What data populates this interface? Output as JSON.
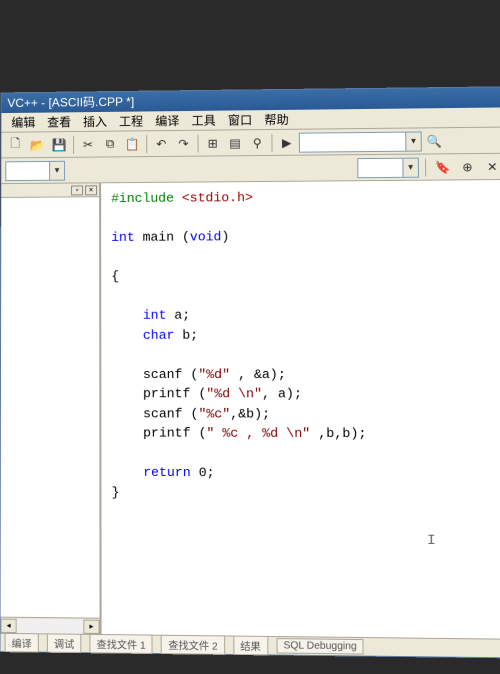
{
  "title": "VC++ - [ASCII码.CPP *]",
  "menu": {
    "items": [
      "编辑",
      "查看",
      "插入",
      "工程",
      "编译",
      "工具",
      "窗口",
      "帮助"
    ]
  },
  "toolbar1": {
    "buttons": [
      "new",
      "open",
      "save",
      "cut",
      "copy",
      "paste",
      "undo",
      "redo",
      "workspace",
      "window",
      "find",
      "run"
    ]
  },
  "code": {
    "include_kw": "#include",
    "include_hdr": "<stdio.h>",
    "int_kw": "int",
    "main": " main (",
    "void_kw": "void",
    "main_close": ")",
    "brace_open": "{",
    "indent": "    ",
    "int_kw2": "int",
    "var_a": " a;",
    "char_kw": "char",
    "var_b": " b;",
    "scanf1_pre": "scanf (",
    "scanf1_str": "\"%d\"",
    "scanf1_post": " , &a);",
    "printf1_pre": "printf (",
    "printf1_str": "\"%d \\n\"",
    "printf1_post": ", a);",
    "scanf2_pre": "scanf (",
    "scanf2_str": "\"%c\"",
    "scanf2_post": ",&b);",
    "printf2_pre": "printf (",
    "printf2_str": "\" %c , %d \\n\"",
    "printf2_post": " ,b,b);",
    "return_kw": "return",
    "return_val": " 0;",
    "brace_close": "}"
  },
  "status": {
    "tabs": [
      "编译",
      "调试",
      "查找文件 1",
      "查找文件 2",
      "结果",
      "SQL Debugging"
    ]
  }
}
